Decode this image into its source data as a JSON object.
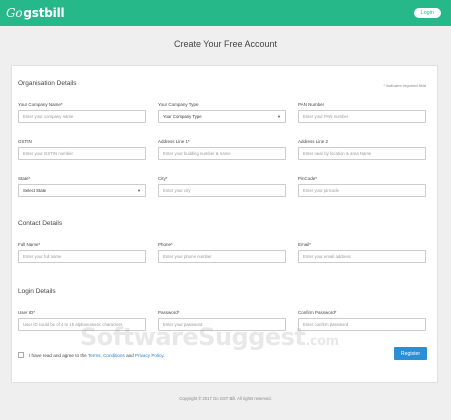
{
  "header": {
    "logo_prefix": "Go",
    "logo_brand": "gstbill",
    "login_label": "Login"
  },
  "page_title": "Create Your Free Account",
  "org": {
    "title": "Organisation Details",
    "required_note": "* indicates required field",
    "company_name": {
      "label": "Your Company Name*",
      "placeholder": "Enter your company name"
    },
    "company_type": {
      "label": "Your Company Type",
      "value": "Your Company Type"
    },
    "pan": {
      "label": "PAN Number",
      "placeholder": "Enter your PAN number"
    },
    "gstin": {
      "label": "GSTIN",
      "placeholder": "Enter your GSTIN number"
    },
    "address1": {
      "label": "Address Line 1*",
      "placeholder": "Enter your building number & name"
    },
    "address2": {
      "label": "Address Line 2",
      "placeholder": "Enter near by location & area Name"
    },
    "state": {
      "label": "State*",
      "value": "Select State"
    },
    "city": {
      "label": "City*",
      "placeholder": "Enter your city"
    },
    "pincode": {
      "label": "PinCode*",
      "placeholder": "Enter your pincode"
    }
  },
  "contact": {
    "title": "Contact Details",
    "full_name": {
      "label": "Full Name*",
      "placeholder": "Enter your full name"
    },
    "phone": {
      "label": "Phone*",
      "placeholder": "Enter your phone number"
    },
    "email": {
      "label": "Email*",
      "placeholder": "Enter your email address"
    }
  },
  "login": {
    "title": "Login Details",
    "user_id": {
      "label": "User ID*",
      "placeholder": "User ID could be of 4 to 15 alphanumeric characters"
    },
    "password": {
      "label": "Password*",
      "placeholder": "Enter your password"
    },
    "confirm": {
      "label": "Confirm Password*",
      "placeholder": "Enter confirm password"
    }
  },
  "agree": {
    "prefix": "I have read and agree to the",
    "terms": "Terms, Conditions",
    "and": "and",
    "privacy": "Privacy Policy."
  },
  "register_label": "Register",
  "watermark": {
    "main": "SoftwareSuggest",
    "suffix": ".com"
  },
  "footer": "Copyright © 2017 Go GST Bill. All rights reserved.",
  "colors": {
    "brand": "#27b88a",
    "primary": "#2a8fd6"
  }
}
